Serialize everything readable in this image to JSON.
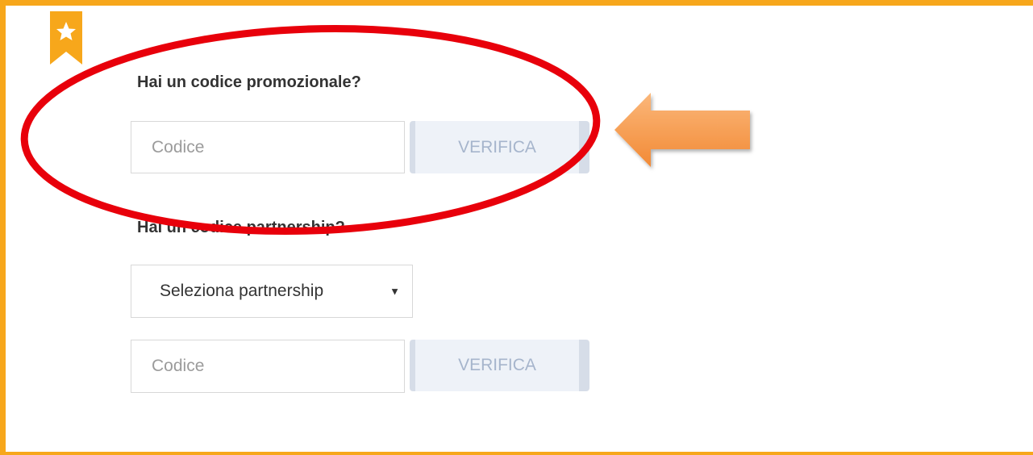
{
  "promo_section": {
    "heading": "Hai un codice promozionale?",
    "code_placeholder": "Codice",
    "verify_label": "VERIFICA"
  },
  "partnership_section": {
    "heading": "Hai un codice partnership?",
    "select_value": "Seleziona partnership",
    "code_placeholder": "Codice",
    "verify_label": "VERIFICA"
  },
  "colors": {
    "border_accent": "#f7a71b",
    "annotation_ellipse": "#e8000b",
    "annotation_arrow": "#f79646",
    "button_bg": "#eef2f8",
    "button_text": "#a6b5cc"
  },
  "icons": {
    "ribbon": "star-bookmark-icon",
    "select_caret": "caret-down-icon",
    "annotation_arrow": "arrow-left-icon"
  }
}
